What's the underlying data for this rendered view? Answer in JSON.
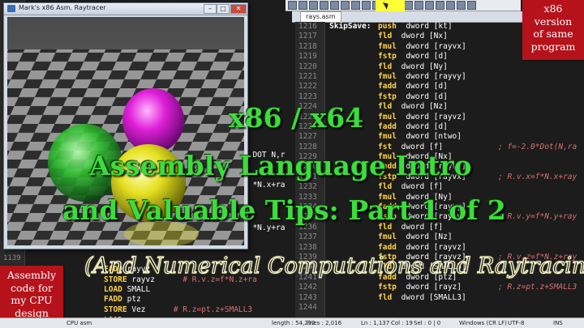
{
  "left_window": {
    "title": "Mark's x86 Asm. Raytracer",
    "minimize": "–",
    "maximize": "□",
    "close": "✕"
  },
  "editor_tab": "rays.asm",
  "right_code": [
    {
      "n": "1216",
      "label": "SkipSave:",
      "op": "push",
      "args": "dword [kt]",
      "comment": ""
    },
    {
      "n": "1217",
      "label": "",
      "op": "fld",
      "args": "dword [Nx]",
      "comment": ""
    },
    {
      "n": "1218",
      "label": "",
      "op": "fmul",
      "args": "dword [rayvx]",
      "comment": ""
    },
    {
      "n": "1219",
      "label": "",
      "op": "fstp",
      "args": "dword [d]",
      "comment": ""
    },
    {
      "n": "1220",
      "label": "",
      "op": "fld",
      "args": "dword [Ny]",
      "comment": ""
    },
    {
      "n": "1221",
      "label": "",
      "op": "fmul",
      "args": "dword [rayvy]",
      "comment": ""
    },
    {
      "n": "1222",
      "label": "",
      "op": "fadd",
      "args": "dword [d]",
      "comment": ""
    },
    {
      "n": "1223",
      "label": "",
      "op": "fstp",
      "args": "dword [d]",
      "comment": ""
    },
    {
      "n": "1224",
      "label": "",
      "op": "fld",
      "args": "dword [Nz]",
      "comment": ""
    },
    {
      "n": "1225",
      "label": "",
      "op": "fmul",
      "args": "dword [rayvz]",
      "comment": ""
    },
    {
      "n": "1226",
      "label": "",
      "op": "fadd",
      "args": "dword [d]",
      "comment": ""
    },
    {
      "n": "1227",
      "label": "",
      "op": "fmul",
      "args": "dword [ntwo]",
      "comment": ""
    },
    {
      "n": "1228",
      "label": "",
      "op": "fst",
      "args": "dword [f]",
      "comment": "; f=-2.0*Dot(N,ra"
    },
    {
      "n": "1229",
      "label": "",
      "op": "fmul",
      "args": "dword [Nx]",
      "comment": ""
    },
    {
      "n": "1230",
      "label": "",
      "op": "fadd",
      "args": "dword [rayvx]",
      "comment": ""
    },
    {
      "n": "1231",
      "label": "",
      "op": "fstp",
      "args": "dword [rayvx]",
      "comment": "; R.v.x=f*N.x+ray"
    },
    {
      "n": "1232",
      "label": "",
      "op": "fld",
      "args": "dword [f]",
      "comment": ""
    },
    {
      "n": "1233",
      "label": "",
      "op": "fmul",
      "args": "dword [Ny]",
      "comment": ""
    },
    {
      "n": "1234",
      "label": "",
      "op": "fadd",
      "args": "dword [rayvy]",
      "comment": ""
    },
    {
      "n": "1235",
      "label": "",
      "op": "fstp",
      "args": "dword [rayvy]",
      "comment": "; R.v.y=f*N.y+ray"
    },
    {
      "n": "1236",
      "label": "",
      "op": "fld",
      "args": "dword [f]",
      "comment": ""
    },
    {
      "n": "1237",
      "label": "",
      "op": "fmul",
      "args": "dword [Nz]",
      "comment": ""
    },
    {
      "n": "1238",
      "label": "",
      "op": "fadd",
      "args": "dword [rayvz]",
      "comment": ""
    },
    {
      "n": "1239",
      "label": "",
      "op": "fstp",
      "args": "dword [rayvz]",
      "comment": "; R.v.z=f*N.z+ray"
    },
    {
      "n": "1240",
      "label": "",
      "op": "fld",
      "args": "dword [SMALL3]",
      "comment": ""
    },
    {
      "n": "1241",
      "label": "",
      "op": "fadd",
      "args": "dword [ptz]",
      "comment": ""
    },
    {
      "n": "1242",
      "label": "",
      "op": "fstp",
      "args": "dword [rayz]",
      "comment": "; R.z=pt.z+SMALL3"
    },
    {
      "n": "1243",
      "label": "",
      "op": "fld",
      "args": "dword [SMALL3]",
      "comment": ""
    },
    {
      "n": "1244",
      "label": "",
      "op": "",
      "args": "",
      "comment": ""
    }
  ],
  "left_code": [
    {
      "n": "",
      "text": "  DOT N,r",
      "cls": ""
    },
    {
      "n": "",
      "text": "  *N.x+ray",
      "cls": ""
    },
    {
      "n": "",
      "text": "  *N.y+ray",
      "cls": ""
    },
    {
      "n": "1139",
      "text": "",
      "cls": ""
    },
    {
      "n": "",
      "op": "FADD",
      "args": "rayvz",
      "comment": ""
    },
    {
      "n": "",
      "op": "STORE",
      "args": "rayvz",
      "comment": "# R.v.z=f*N.z+ra"
    },
    {
      "n": "",
      "op": "LOAD",
      "args": "SMALL",
      "comment": ""
    },
    {
      "n": "",
      "op": "FADD",
      "args": "ptz",
      "comment": ""
    },
    {
      "n": "",
      "op": "STORE",
      "args": "Vez",
      "comment": "# R.z=pt.z+SMALL3"
    },
    {
      "n": "",
      "op": "LOAD",
      "args": "rayvz",
      "comment": ""
    }
  ],
  "titles": {
    "line1": "x86 / x64",
    "line2": "Assembly Language Intro",
    "line3": "and Valuable Tips: Part 1 of 2",
    "subtitle": "(And Numerical Computations and Raytracing)"
  },
  "badges": {
    "right": [
      "x86",
      "version",
      "of same",
      "program"
    ],
    "left": [
      "Assembly",
      "code for",
      "my CPU",
      "design"
    ]
  },
  "status_bar": {
    "left": "CPU asm",
    "length": "length : 54,292",
    "lines": "lines : 2,016",
    "ln": "Ln : 1,137",
    "col": "Col : 19",
    "sel": "Sel : 0 | 0",
    "eol": "Windows (CR LF)",
    "enc": "UTF-8",
    "mode": "INS"
  }
}
